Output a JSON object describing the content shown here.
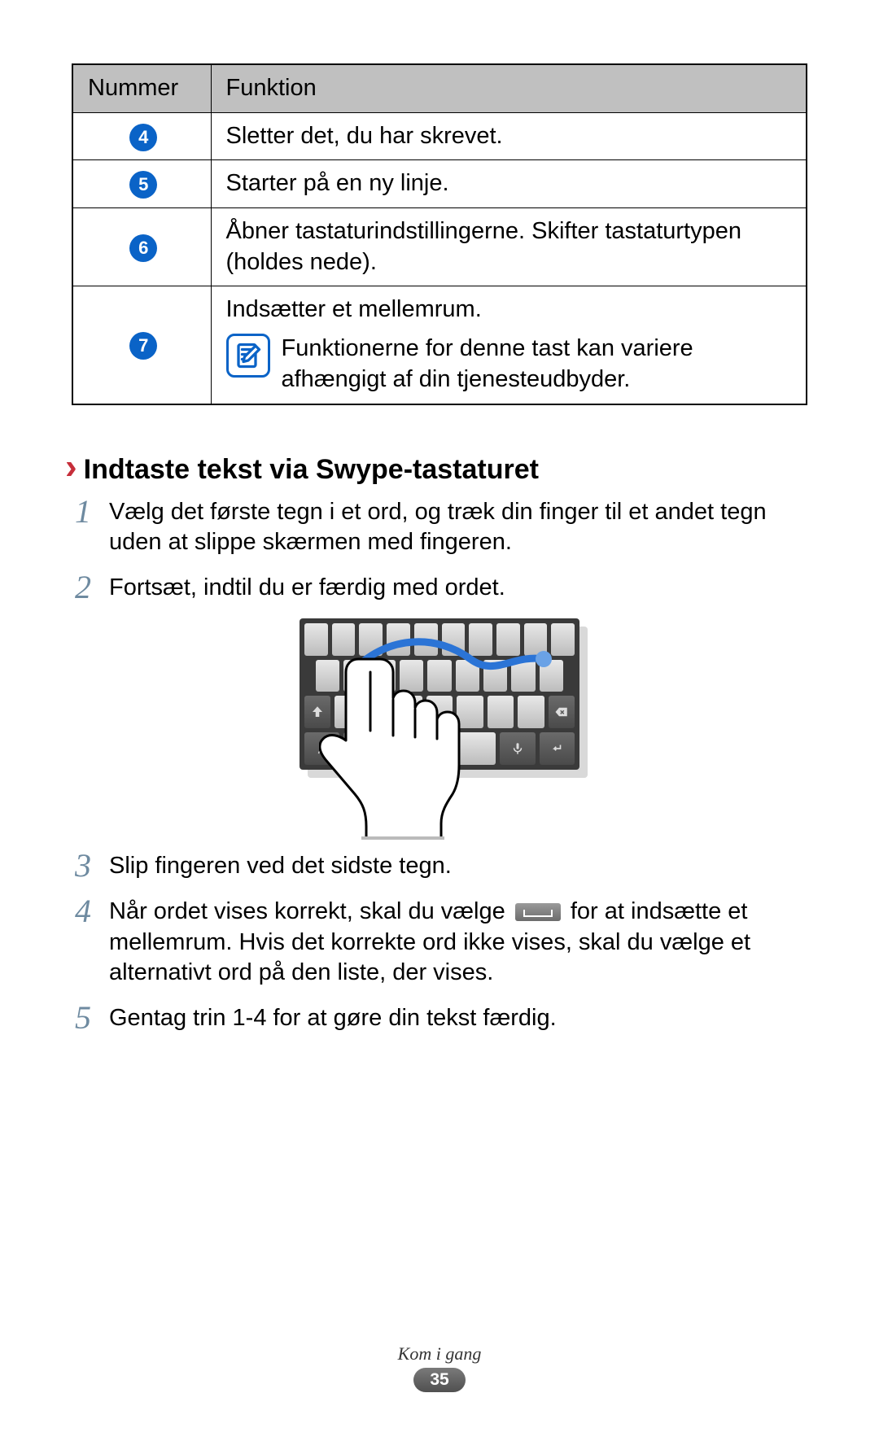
{
  "table": {
    "headers": {
      "num": "Nummer",
      "func": "Funktion"
    },
    "rows": [
      {
        "n": "4",
        "text": "Sletter det, du har skrevet."
      },
      {
        "n": "5",
        "text": "Starter på en ny linje."
      },
      {
        "n": "6",
        "text": "Åbner tastaturindstillingerne. Skifter tastaturtypen (holdes nede)."
      },
      {
        "n": "7",
        "text": "Indsætter et mellemrum.",
        "note": "Funktionerne for denne tast kan variere afhængigt af din tjenesteudbyder."
      }
    ]
  },
  "section": {
    "chevron": "›",
    "title": "Indtaste tekst via Swype-tastaturet"
  },
  "steps": {
    "s1": {
      "n": "1",
      "text": "Vælg det første tegn i et ord, og træk din finger til et andet tegn uden at slippe skærmen med fingeren."
    },
    "s2": {
      "n": "2",
      "text": "Fortsæt, indtil du er færdig med ordet."
    },
    "s3": {
      "n": "3",
      "text": "Slip fingeren ved det sidste tegn."
    },
    "s4": {
      "n": "4",
      "pre": "Når ordet vises korrekt, skal du vælge ",
      "post": " for at indsætte et mellemrum. Hvis det korrekte ord ikke vises, skal du vælge et alternativt ord på den liste, der vises."
    },
    "s5": {
      "n": "5",
      "text": "Gentag trin 1-4 for at gøre din tekst færdig."
    }
  },
  "footer": {
    "section": "Kom i gang",
    "page": "35"
  }
}
